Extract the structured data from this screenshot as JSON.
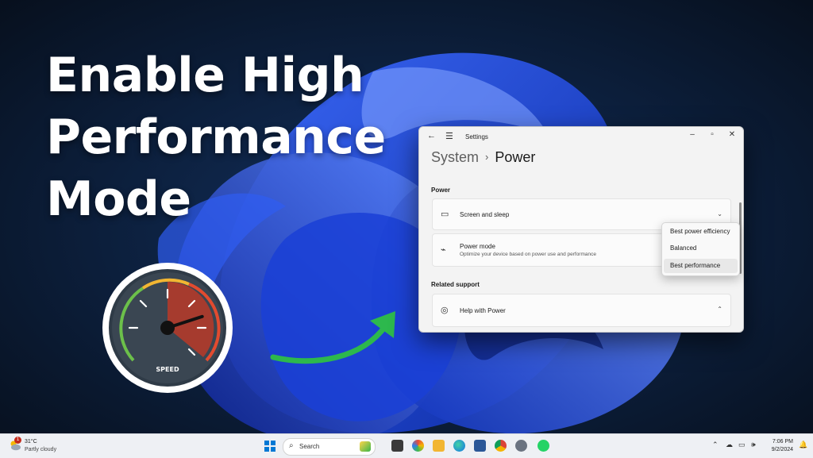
{
  "headline": {
    "line1": "Enable High",
    "line2": "Performance",
    "line3": "Mode"
  },
  "gauge": {
    "label": "SPEED",
    "level": 0.8
  },
  "settings_window": {
    "app_title": "Settings",
    "breadcrumb": {
      "parent": "System",
      "separator": "›",
      "current": "Power"
    },
    "power_section_label": "Power",
    "screen_sleep": {
      "label": "Screen and sleep"
    },
    "power_mode": {
      "label": "Power mode",
      "description": "Optimize your device based on power use and performance"
    },
    "related_support_label": "Related support",
    "help": {
      "label": "Help with Power"
    }
  },
  "power_mode_dropdown": {
    "options": [
      "Best power efficiency",
      "Balanced",
      "Best performance"
    ],
    "highlighted": "Best performance"
  },
  "taskbar": {
    "weather": {
      "temp": "31°C",
      "condition": "Partly cloudy",
      "badge": "1"
    },
    "search_placeholder": "Search",
    "clock": {
      "time": "7:06 PM",
      "date": "9/2/2024"
    }
  },
  "colors": {
    "accent": "#0078d4",
    "arrow": "#2db84d",
    "gauge_needle_zone": "#c0392b",
    "wallpaper_bloom": "#1f4fe0"
  }
}
